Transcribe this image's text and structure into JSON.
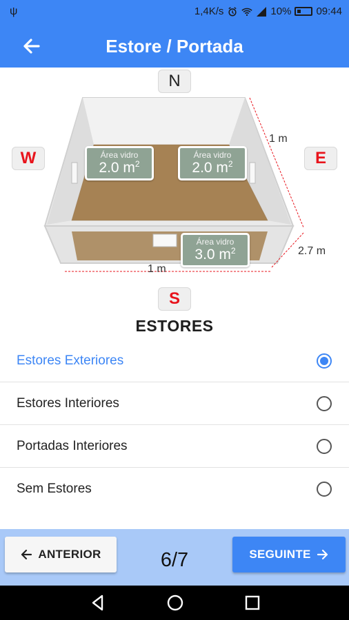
{
  "status_bar": {
    "network_speed": "1,4K/s",
    "battery_percent": "10%",
    "time": "09:44",
    "icons": [
      "usb-icon",
      "alarm-icon",
      "wifi-icon",
      "signal-icon",
      "battery-icon"
    ]
  },
  "app_bar": {
    "title": "Estore / Portada",
    "back_icon": "arrow-left-icon"
  },
  "room": {
    "compass": {
      "north": "N",
      "south": "S",
      "west": "W",
      "east": "E"
    },
    "windows": [
      {
        "label": "Área vidro",
        "value": "2.0 m",
        "unit_exp": "2",
        "wall": "west"
      },
      {
        "label": "Área vidro",
        "value": "2.0 m",
        "unit_exp": "2",
        "wall": "east"
      },
      {
        "label": "Área vidro",
        "value": "3.0 m",
        "unit_exp": "2",
        "wall": "south"
      }
    ],
    "dimensions": {
      "depth": "1 m",
      "width": "1 m",
      "height": "2.7 m"
    }
  },
  "section_title": "ESTORES",
  "options": [
    {
      "label": "Estores Exteriores",
      "selected": true
    },
    {
      "label": "Estores Interiores",
      "selected": false
    },
    {
      "label": "Portadas Interiores",
      "selected": false
    },
    {
      "label": "Sem Estores",
      "selected": false
    }
  ],
  "footer": {
    "prev_label": "ANTERIOR",
    "next_label": "SEGUINTE",
    "page": "6/7"
  },
  "colors": {
    "primary": "#3d86f5",
    "footer_bg": "#a9c9f8",
    "compass_red": "#e8141c",
    "glass_green": "#8fa394"
  }
}
